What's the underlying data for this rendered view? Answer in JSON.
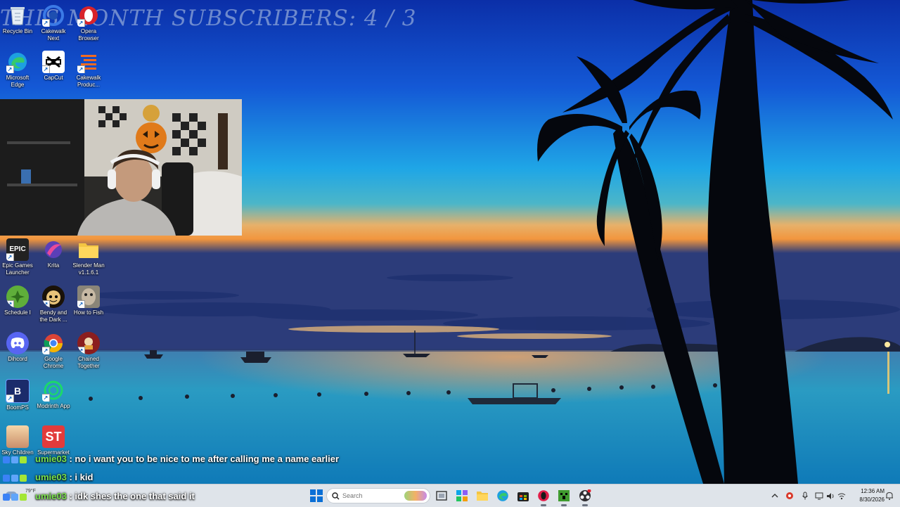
{
  "overlay": {
    "title": "THIS MONTH SUBSCRIBERS: 4 / 3"
  },
  "desktop_icons": [
    {
      "label": "Recycle Bin",
      "icon": "recycle-bin-icon"
    },
    {
      "label": "Cakewalk Next",
      "icon": "cakewalk-next-icon"
    },
    {
      "label": "Opera Browser",
      "icon": "opera-icon"
    },
    {
      "label": "Microsoft Edge",
      "icon": "edge-icon"
    },
    {
      "label": "CapCut",
      "icon": "capcut-icon"
    },
    {
      "label": "Cakewalk Produc...",
      "icon": "cakewalk-producer-icon"
    },
    {
      "label": "Epic Games Launcher",
      "icon": "epic-games-icon"
    },
    {
      "label": "Krita",
      "icon": "krita-icon"
    },
    {
      "label": "Slender Man v1.1.6.1",
      "icon": "folder-icon"
    },
    {
      "label": "Schedule I",
      "icon": "schedule-i-icon"
    },
    {
      "label": "Bendy and the Dark ...",
      "icon": "bendy-icon"
    },
    {
      "label": "How to Fish",
      "icon": "how-to-fish-icon"
    },
    {
      "label": "Dihcord",
      "icon": "discord-icon"
    },
    {
      "label": "Google Chrome",
      "icon": "chrome-icon"
    },
    {
      "label": "Chained Together",
      "icon": "chained-together-icon"
    },
    {
      "label": "BoomPS",
      "icon": "boomps-icon"
    },
    {
      "label": "Modrinth App",
      "icon": "modrinth-icon"
    },
    {
      "label": "Sky Children",
      "icon": "sky-icon"
    },
    {
      "label": "Supermarket",
      "icon": "supermarket-icon"
    }
  ],
  "chat": [
    {
      "user": "umie03",
      "sep": ":",
      "message": "no i want you to be nice to me after calling me a name earlier"
    },
    {
      "user": "umie03",
      "sep": ":",
      "message": "i kid"
    },
    {
      "user": "umie03",
      "sep": ":",
      "message": "idk shes the one that said it"
    }
  ],
  "taskbar": {
    "weather_temp": "79°F",
    "search_placeholder": "Search",
    "pinned": [
      "start-icon",
      "search-icon",
      "task-view-icon",
      "copilot-icon",
      "file-explorer-icon",
      "edge-icon",
      "store-icon",
      "opera-gx-icon",
      "minecraft-icon",
      "obs-icon"
    ],
    "tray": [
      "chevron-up-icon",
      "steelseries-icon",
      "microphone-icon",
      "speaker-icon",
      "network-icon",
      "battery-icon",
      "chat-bubble-icon"
    ],
    "time": "12:36 AM",
    "date": "8/30/2026"
  },
  "colors": {
    "username": "#79e04c",
    "taskbar_bg": "#dfe4ea",
    "accent": "#1e6fd9"
  }
}
